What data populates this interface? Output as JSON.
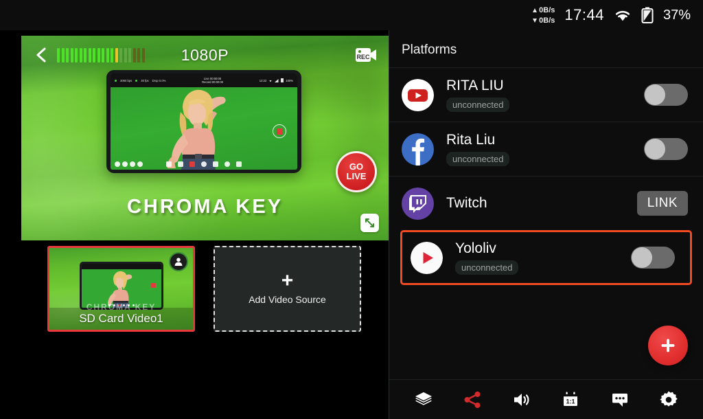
{
  "status_bar": {
    "upload_speed": "0B/s",
    "download_speed": "0B/s",
    "time": "17:44",
    "wifi_icon": "wifi-icon",
    "battery_icon": "battery-icon",
    "battery_percent": "37%"
  },
  "preview": {
    "back_icon": "back-chevron-icon",
    "resolution": "1080P",
    "rec_icon": "rec-icon",
    "overlay_title": "CHROMA KEY",
    "go_live_line1": "GO",
    "go_live_line2": "LIVE",
    "fullscreen_icon": "fullscreen-icon",
    "audio_meter": {
      "total_bars": 20,
      "active_bars": 13,
      "peak_bar_index": 13
    },
    "device_mock": {
      "bitrate": "3060 bps",
      "fps": "30 fps",
      "drop": "Drop 0.0%",
      "live_timer": "Live 00:00:00",
      "record_timer": "Record 00:00:00",
      "clock": "12:22",
      "battery": "100%"
    }
  },
  "sources": {
    "selected_card": {
      "overlay_text": "CHROMA KEY",
      "label": "SD Card Video1",
      "badge_icon": "person-icon"
    },
    "add_card": {
      "plus_icon": "plus-icon",
      "label": "Add Video Source"
    }
  },
  "platforms_panel": {
    "title": "Platforms",
    "rows": [
      {
        "icon": "youtube-icon",
        "name": "RITA LIU",
        "status": "unconnected",
        "control": "toggle",
        "toggle_on": false,
        "highlighted": false
      },
      {
        "icon": "facebook-icon",
        "name": "Rita Liu",
        "status": "unconnected",
        "control": "toggle",
        "toggle_on": false,
        "highlighted": false
      },
      {
        "icon": "twitch-icon",
        "name": "Twitch",
        "status": "",
        "control": "button",
        "button_label": "LINK",
        "highlighted": false
      },
      {
        "icon": "yololiv-icon",
        "name": "Yololiv",
        "status": "unconnected",
        "control": "toggle",
        "toggle_on": false,
        "highlighted": true
      }
    ],
    "fab": {
      "icon": "plus-icon"
    },
    "toolbar": [
      {
        "icon": "layers-icon",
        "accent": "#ffffff"
      },
      {
        "icon": "share-icon",
        "accent": "#d32b2b"
      },
      {
        "icon": "volume-icon",
        "accent": "#ffffff"
      },
      {
        "icon": "aspect-ratio-icon",
        "accent": "#ffffff",
        "label": "1:1"
      },
      {
        "icon": "chat-icon",
        "accent": "#ffffff"
      },
      {
        "icon": "settings-gear-icon",
        "accent": "#ffffff"
      }
    ]
  },
  "colors": {
    "highlight_border": "#f04b23",
    "selection_border": "#e8393c",
    "live_red": "#cf1f22",
    "fab_red": "#e02c2c",
    "panel_bg": "#0d0d0d"
  }
}
